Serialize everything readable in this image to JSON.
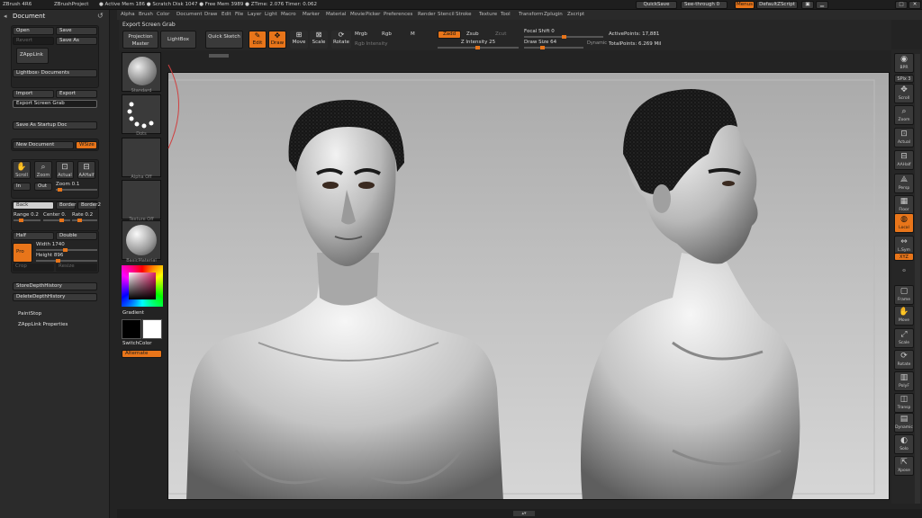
{
  "titlebar": {
    "app": "ZBrush 4R6",
    "project": "ZBrushProject",
    "stats": "● Active Mem 186 ● Scratch Disk 1047 ● Free Mem 3989 ● ZTime: 2.076 Timer: 0.062"
  },
  "topright": {
    "quicksave": "QuickSave",
    "seethrough": "See-through  0",
    "menus": "Menus",
    "script": "DefaultZScript"
  },
  "menus": [
    "Alpha",
    "Brush",
    "Color",
    "Document",
    "Draw",
    "Edit",
    "File",
    "Layer",
    "Light",
    "Macro",
    "Marker",
    "Material",
    "Movie",
    "Picker",
    "Preferences",
    "Render",
    "Stencil",
    "Stroke",
    "Texture",
    "Tool",
    "Transform",
    "Zplugin",
    "Zscript"
  ],
  "document_panel": {
    "title": "Document",
    "open": "Open",
    "save": "Save",
    "revert": "Revert",
    "save_as": "Save As",
    "zapplink": "ZAppLink",
    "lightbox_documents": "Lightbox› Documents",
    "import": "Import",
    "export": "Export",
    "export_screen_grab": "Export Screen Grab",
    "save_as_startup": "Save As Startup Doc",
    "new_document": "New Document",
    "wsize": "WSize",
    "scroll": "Scroll",
    "zoom": "Zoom",
    "actual": "Actual",
    "aahalf": "AAHalf",
    "in": "In",
    "out": "Out",
    "zoom_slider": "Zoom 0.1",
    "back": "Back",
    "border": "Border",
    "border2": "Border2",
    "range": "Range 0.2",
    "center": "Center 0.",
    "rate": "Rate 0.2",
    "half": "Half",
    "double": "Double",
    "pro": "Pro",
    "width": "Width 1740",
    "height": "Height 896",
    "crop": "Crop",
    "resize": "Resize",
    "store_depth": "StoreDepthHistory",
    "delete_depth": "DeleteDepthHistory",
    "paintstop": "PaintStop",
    "zapplink_props": "ZAppLink Properties"
  },
  "toolbar": {
    "tooltip": "Export Screen Grab",
    "projection_master": "Projection Master",
    "lightbox": "LightBox",
    "quick_sketch": "Quick Sketch",
    "edit": "Edit",
    "draw": "Draw",
    "move": "Move",
    "scale": "Scale",
    "rotate": "Rotate",
    "mrgb": "Mrgb",
    "rgb": "Rgb",
    "m": "M",
    "rgb_intensity": "Rgb Intensity",
    "zadd": "Zadd",
    "zsub": "Zsub",
    "zcut": "Zcut",
    "z_intensity": "Z Intensity 25",
    "focal_shift": "Focal Shift 0",
    "draw_size": "Draw Size 64",
    "dynamic": "Dynamic",
    "active_points": "ActivePoints: 17,881",
    "total_points": "TotalPoints: 6.269 Mil"
  },
  "shelf": {
    "brush": "Standard",
    "stroke": "Dots",
    "alpha": "Alpha Off",
    "texture": "Texture Off",
    "material": "BasicMaterial",
    "gradient": "Gradient",
    "switchcolor": "SwitchColor",
    "alternate": "Alternate"
  },
  "rightshelf": [
    "BPR",
    "SPix 3",
    "Scroll",
    "Zoom",
    "Actual",
    "AAHalf",
    "Persp",
    "Floor",
    "Local",
    "L.Sym",
    "XYZ",
    "",
    "Frame",
    "Move",
    "Scale",
    "Rotate",
    "PolyF",
    "Transp",
    "Dynamic",
    "Solo",
    "Xpose"
  ],
  "colors": {
    "accent": "#e8751a",
    "panel": "#2b2b2b"
  }
}
